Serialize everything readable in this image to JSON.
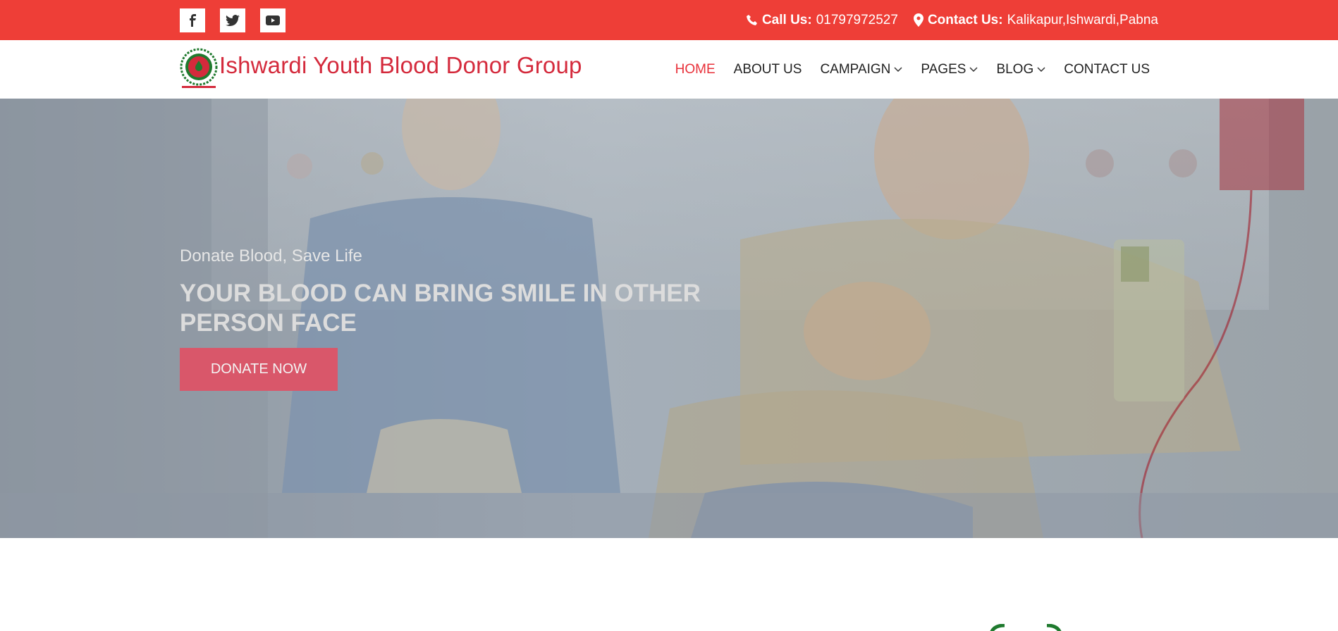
{
  "topbar": {
    "social": [
      {
        "name": "facebook-icon"
      },
      {
        "name": "twitter-icon"
      },
      {
        "name": "youtube-icon"
      }
    ],
    "call_label": "Call Us:",
    "call_value": "01797972527",
    "contact_label": "Contact Us:",
    "contact_value": "Kalikapur,Ishwardi,Pabna"
  },
  "header": {
    "brand": "Ishwardi Youth Blood Donor Group",
    "menu": [
      {
        "label": "HOME",
        "active": true
      },
      {
        "label": "ABOUT US"
      },
      {
        "label": "CAMPAIGN",
        "dropdown": true
      },
      {
        "label": "PAGES",
        "dropdown": true
      },
      {
        "label": "BLOG",
        "dropdown": true
      },
      {
        "label": "CONTACT US"
      }
    ]
  },
  "hero": {
    "subtitle": "Donate Blood, Save Life",
    "title": "YOUR BLOOD CAN BRING SMILE IN OTHER PERSON FACE",
    "button": "DONATE NOW"
  },
  "colors": {
    "topbar": "#ee3e37",
    "brand": "#d42a3c",
    "active_nav": "#e8313a",
    "button": "#d9576a"
  }
}
